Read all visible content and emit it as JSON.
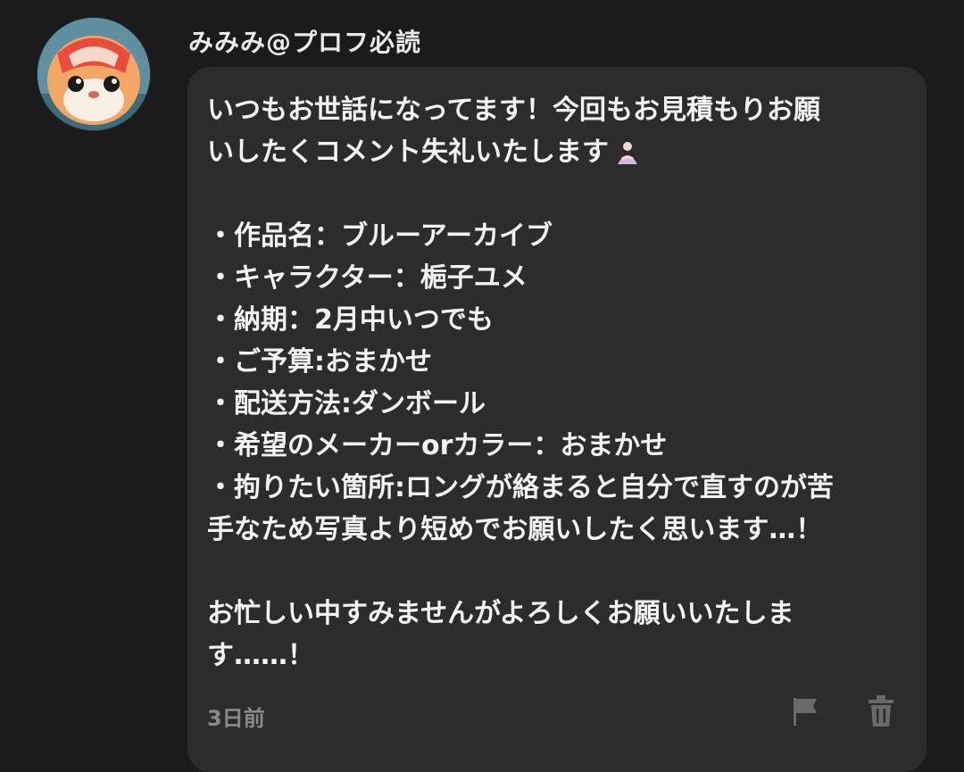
{
  "comment": {
    "username": "みみみ@プロフ必読",
    "lines": [
      "いつもお世話になってます！今回もお見積もりお願",
      "いしたくコメント失礼いたします",
      "",
      "・作品名：ブルーアーカイブ",
      "・キャラクター：梔子ユメ",
      "・納期：2月中いつでも",
      "・ご予算:おまかせ",
      "・配送方法:ダンボール",
      "・希望のメーカーorカラー：おまかせ",
      "・拘りたい箇所:ロングが絡まると自分で直すのが苦",
      "手なため写真より短めでお願いしたく思います…！",
      "",
      "お忙しい中すみませんがよろしくお願いいたしま",
      "す……！"
    ],
    "timestamp": "3日前",
    "icons": {
      "avatar": "hamster-avatar",
      "emoji": "person-bowing-emoji",
      "flag": "flag-icon",
      "delete": "trash-icon"
    }
  }
}
